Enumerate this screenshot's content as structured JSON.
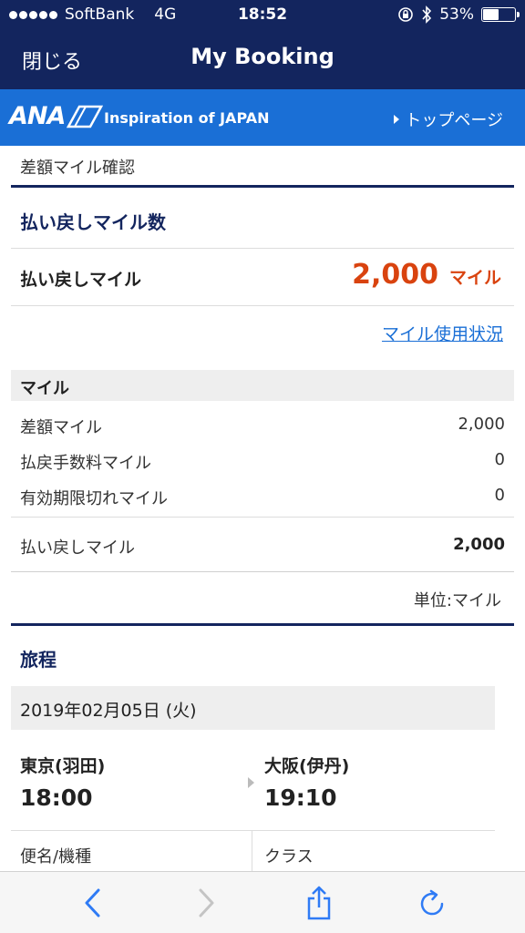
{
  "status_bar": {
    "carrier": "SoftBank",
    "network": "4G",
    "time": "18:52",
    "battery": "53%",
    "battery_level": 0.53
  },
  "nav": {
    "close_label": "閉じる",
    "title": "My Booking"
  },
  "brand": {
    "logo": "ANA",
    "tagline": "Inspiration of JAPAN",
    "top_link": "トップページ"
  },
  "breadcrumb": "差額マイル確認",
  "refund_section": {
    "heading": "払い戻しマイル数",
    "label": "払い戻しマイル",
    "value": "2,000",
    "unit": "マイル",
    "usage_link": "マイル使用状況"
  },
  "miles_table": {
    "header": "マイル",
    "rows": [
      {
        "label": "差額マイル",
        "value": "2,000"
      },
      {
        "label": "払戻手数料マイル",
        "value": "0"
      },
      {
        "label": "有効期限切れマイル",
        "value": "0"
      }
    ],
    "total": {
      "label": "払い戻しマイル",
      "value": "2,000"
    },
    "unit_note": "単位:マイル"
  },
  "itinerary": {
    "heading": "旅程",
    "date": "2019年02月05日 (火)",
    "departure": {
      "city": "東京(羽田)",
      "time": "18:00"
    },
    "arrival": {
      "city": "大阪(伊丹)",
      "time": "19:10"
    },
    "flight_label": "便名/機種",
    "class_label": "クラス"
  },
  "colors": {
    "navy": "#13255e",
    "brand_blue": "#1a6fd6",
    "accent_red": "#d9430f",
    "ios_blue": "#2f7bf5"
  },
  "toolbar": {
    "icons": [
      "back-icon",
      "forward-icon",
      "share-icon",
      "reload-icon"
    ]
  }
}
